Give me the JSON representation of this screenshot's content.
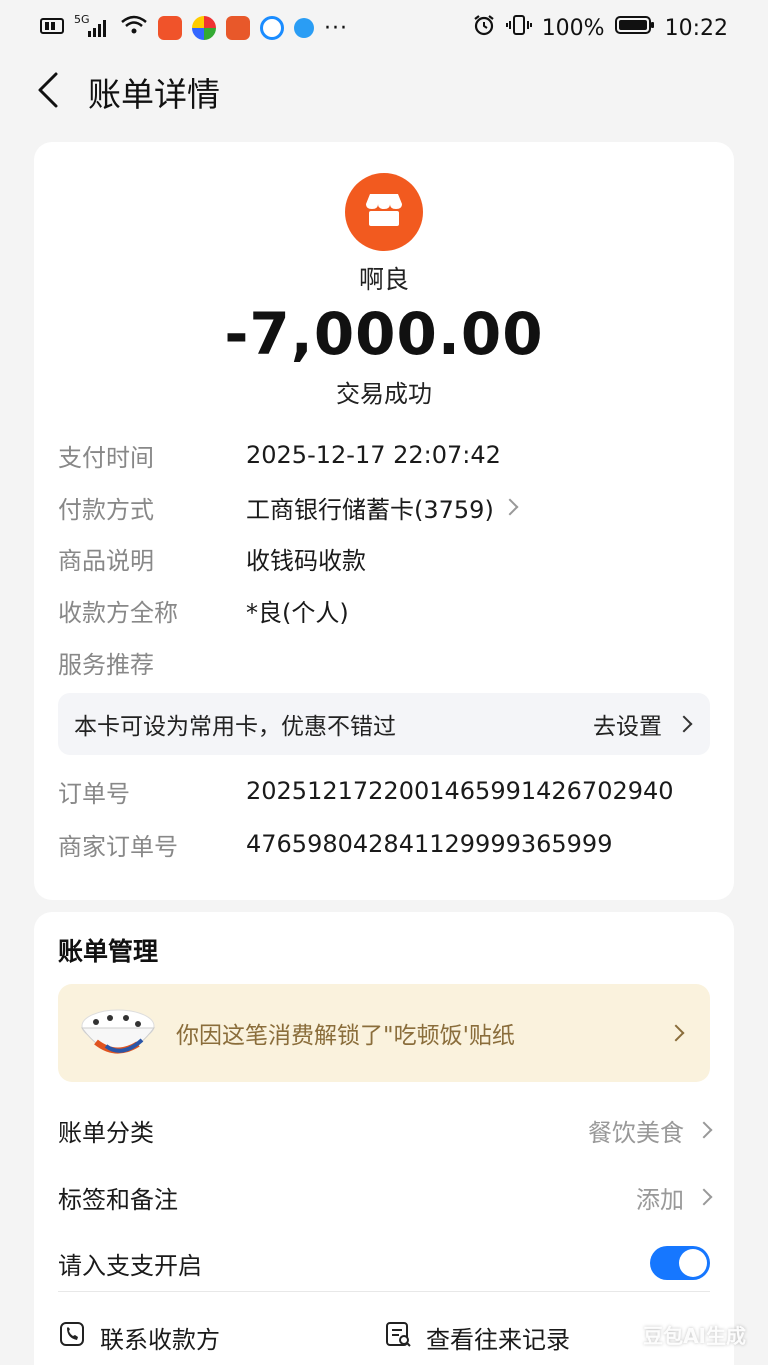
{
  "status_bar": {
    "network": "5G",
    "battery": "100%",
    "time": "10:22",
    "more": "···",
    "icons": [
      "sim-icon",
      "signal-icon",
      "wifi-icon",
      "app-icon",
      "app-icon",
      "app-icon",
      "app-icon",
      "app-icon",
      "alarm-icon",
      "vibrate-icon",
      "battery-icon"
    ]
  },
  "header": {
    "title": "账单详情",
    "back_icon": "chevron-left-icon"
  },
  "merchant": {
    "name": "啊良",
    "logo_icon": "store-icon",
    "logo_color": "#f25a1f"
  },
  "transaction": {
    "amount": "-7,000.00",
    "status": "交易成功"
  },
  "details": [
    {
      "label": "支付时间",
      "value": "2025-12-17 22:07:42",
      "chevron": false
    },
    {
      "label": "付款方式",
      "value": "工商银行储蓄卡(3759)",
      "chevron": true
    },
    {
      "label": "商品说明",
      "value": "收钱码收款",
      "chevron": false
    },
    {
      "label": "收款方全称",
      "value": "*良(个人)",
      "chevron": false
    },
    {
      "label": "服务推荐",
      "value": "",
      "chevron": false
    }
  ],
  "promo": {
    "text": "本卡可设为常用卡，优惠不错过",
    "action": "去设置"
  },
  "orders": [
    {
      "label": "订单号",
      "value": "2025121722001465991426702940"
    },
    {
      "label": "商家订单号",
      "value": "476598042841129999365999"
    }
  ],
  "manage": {
    "title": "账单管理",
    "sticker_banner": "你因这笔消费解锁了\"吃顿饭'贴纸",
    "category_label": "账单分类",
    "category_value": "餐饮美食",
    "tags_label": "标签和备注",
    "tags_value": "添加",
    "budget_label": "请入支支开启",
    "budget_enabled": true,
    "accent_color": "#1677ff"
  },
  "actions": {
    "contact": "联系收款方",
    "history": "查看往来记录"
  },
  "watermark": "豆包AI生成"
}
